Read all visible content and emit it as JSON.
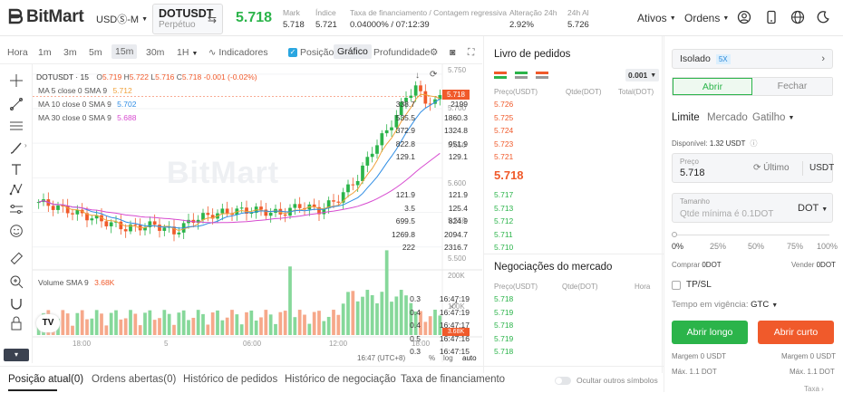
{
  "header": {
    "brand": "BitMart",
    "market_type": "USDⓈ-M",
    "symbol": "DOTUSDT",
    "symbol_sub": "Perpétuo",
    "last_price": "5.718",
    "stats": [
      {
        "label": "Mark",
        "value": "5.718",
        "color": "normal"
      },
      {
        "label": "Índice",
        "value": "5.721",
        "color": "normal"
      },
      {
        "label": "Taxa de financiamento / Contagem regressiva",
        "value": "0.04000% / 07:12:39",
        "color": "normal"
      },
      {
        "label": "Alteração 24h",
        "value": "2.92%",
        "color": "green"
      },
      {
        "label": "24h Al",
        "value": "5.726",
        "color": "normal"
      }
    ],
    "nav": [
      "Ativos",
      "Ordens"
    ]
  },
  "toolbar": {
    "intervals": [
      "Hora",
      "1m",
      "3m",
      "5m",
      "15m",
      "30m",
      "1H"
    ],
    "selected_interval": "15m",
    "indicators_label": "Indicadores",
    "position_label": "Posição",
    "chart_label": "Gráfico",
    "depth_label": "Profundidade"
  },
  "chart": {
    "title": "DOTUSDT · 15",
    "ohlc": {
      "o_label": "O",
      "o": "5.719",
      "h_label": "H",
      "h": "5.722",
      "l_label": "L",
      "l": "5.716",
      "c_label": "C",
      "c": "5.718",
      "chg": "-0.001 (-0.02%)"
    },
    "ma5": {
      "label": "MA 5 close 0 SMA 9",
      "value": "5.712",
      "color": "#f0a23c"
    },
    "ma10": {
      "label": "MA 10 close 0 SMA 9",
      "value": "5.702",
      "color": "#2f8de4"
    },
    "ma30": {
      "label": "MA 30 close 0 SMA 9",
      "value": "5.688",
      "color": "#d74bd0"
    },
    "volume": {
      "label": "Volume SMA 9",
      "value": "3.68K"
    },
    "price_ticks": [
      "5.750",
      "5.700",
      "5.650",
      "5.600",
      "5.550",
      "5.500"
    ],
    "current_tag": "5.718",
    "vol_ticks": [
      "200K",
      "100K"
    ],
    "vol_tag": "3.68K",
    "time_ticks": [
      "18:00",
      "5",
      "06:00",
      "12:00",
      "18:00"
    ],
    "clock": "16:47 (UTC+8)",
    "percent_label": "%",
    "log_label": "log",
    "auto_label": "auto",
    "watermark": "BitMart"
  },
  "chart_data": {
    "type": "candlestick",
    "ylim": [
      5.48,
      5.755
    ],
    "ma_colors": [
      "#f0a23c",
      "#2f8de4",
      "#d74bd0"
    ]
  },
  "orderbook": {
    "title": "Livro de pedidos",
    "precision": "0.001",
    "headers": [
      "Preço(USDT)",
      "Qtde(DOT)",
      "Total(DOT)"
    ],
    "asks": [
      [
        "5.726",
        "338.7",
        "2199"
      ],
      [
        "5.725",
        "535.5",
        "1860.3"
      ],
      [
        "5.724",
        "372.9",
        "1324.8"
      ],
      [
        "5.723",
        "822.8",
        "951.9"
      ],
      [
        "5.721",
        "129.1",
        "129.1"
      ]
    ],
    "mid": "5.718",
    "bids": [
      [
        "5.717",
        "121.9",
        "121.9"
      ],
      [
        "5.713",
        "3.5",
        "125.4"
      ],
      [
        "5.712",
        "699.5",
        "824.9"
      ],
      [
        "5.711",
        "1269.8",
        "2094.7"
      ],
      [
        "5.710",
        "222",
        "2316.7"
      ]
    ]
  },
  "trades": {
    "title": "Negociações do mercado",
    "headers": [
      "Preço(USDT)",
      "Qtde(DOT)",
      "Hora"
    ],
    "rows": [
      [
        "5.718",
        "0.3",
        "16:47:19"
      ],
      [
        "5.719",
        "0.4",
        "16:47:19"
      ],
      [
        "5.718",
        "0.4",
        "16:47:17"
      ],
      [
        "5.719",
        "0.5",
        "16:47:16"
      ],
      [
        "5.718",
        "0.3",
        "16:47:15"
      ]
    ]
  },
  "order_panel": {
    "margin_mode": "Isolado",
    "leverage": "5X",
    "open_label": "Abrir",
    "close_label": "Fechar",
    "types": [
      "Limite",
      "Mercado",
      "Gatilho"
    ],
    "available_label": "Disponível:",
    "available_value": "1.32 USDT",
    "price_label": "Preço",
    "price_value": "5.718",
    "last_label": "Último",
    "price_unit": "USDT",
    "size_label": "Tamanho",
    "size_placeholder": "Qtde mínima é 0.1DOT",
    "size_unit": "DOT",
    "slider_marks": [
      "0%",
      "25%",
      "50%",
      "75%",
      "100%"
    ],
    "buy_label": "Comprar",
    "buy_value": "0DOT",
    "sell_label": "Vender",
    "sell_value": "0DOT",
    "tpsl_label": "TP/SL",
    "tif_label": "Tempo em vigência:",
    "tif_value": "GTC",
    "long_button": "Abrir longo",
    "short_button": "Abrir curto",
    "margin_long": "Margem 0 USDT",
    "margin_short": "Margem 0 USDT",
    "max_long": "Máx. 1.1 DOT",
    "max_short": "Máx. 1.1 DOT",
    "fees_label": "Taxa"
  },
  "bottom_tabs": {
    "tabs": [
      "Posição atual(0)",
      "Ordens abertas(0)",
      "Histórico de pedidos",
      "Histórico de negociação",
      "Taxa de financiamento"
    ],
    "hide_label": "Ocultar outros símbolos"
  }
}
